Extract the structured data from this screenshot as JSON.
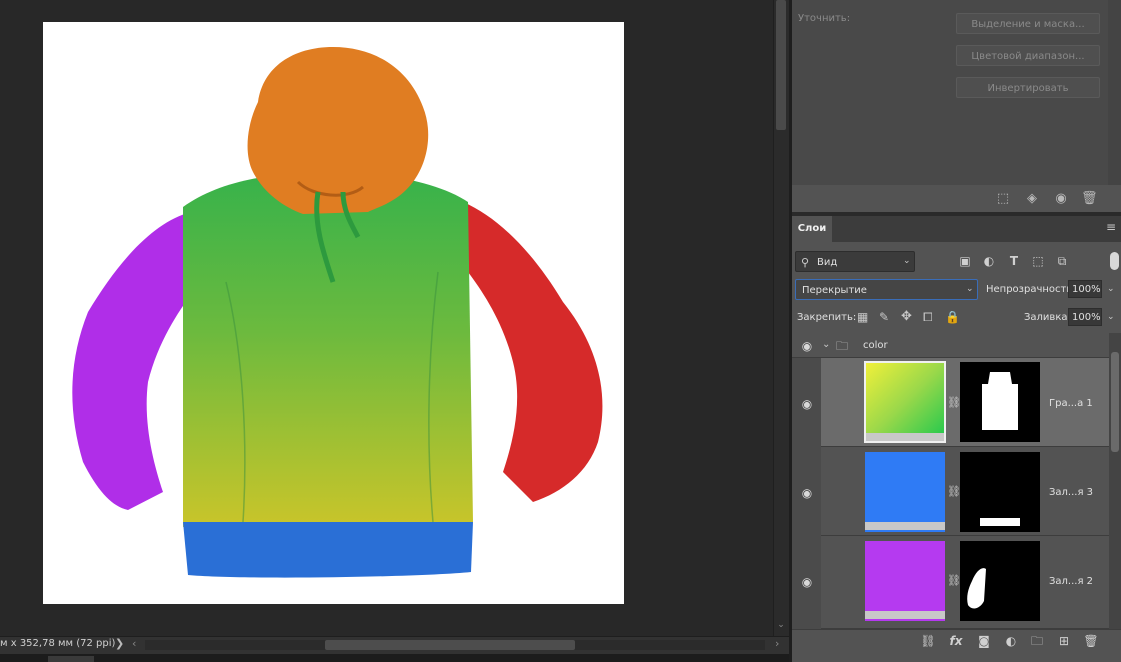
{
  "status": {
    "doc_info": "м x 352,78 мм (72 ppi)",
    "arrow": "❯",
    "scroll_left": "‹",
    "scroll_right": "›"
  },
  "properties": {
    "refine_label": "Уточнить:",
    "select_mask_button": "Выделение и маска...",
    "color_range_button": "Цветовой диапазон...",
    "invert_button": "Инвертировать"
  },
  "layers": {
    "tab_label": "Слои",
    "filter_label": "Вид",
    "blend_mode": "Перекрытие",
    "opacity_label": "Непрозрачность:",
    "opacity_value": "100%",
    "lock_label": "Закрепить:",
    "fill_label": "Заливка:",
    "fill_value": "100%",
    "group_name": "color",
    "items": [
      {
        "name": "Гра...а 1",
        "color": "#e8e83a"
      },
      {
        "name": "Зал...я 3",
        "color": "#2f7bf5"
      },
      {
        "name": "Зал...я 2",
        "color": "#b53af0"
      }
    ]
  },
  "colors": {
    "hood": "#e07d22",
    "left_sleeve": "#b02ee8",
    "right_sleeve": "#d62a2a",
    "hem": "#2a6fd6",
    "body_top": "#3ab24a",
    "body_bottom": "#c8c828",
    "selection_accent": "#3a6db8"
  }
}
